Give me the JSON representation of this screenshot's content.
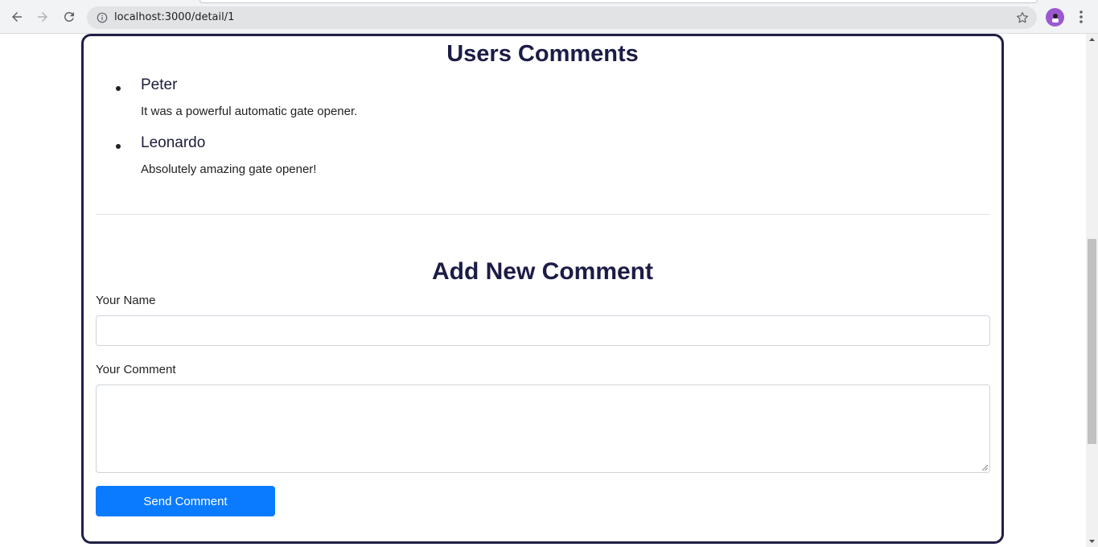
{
  "browser": {
    "url": "localhost:3000/detail/1",
    "back_icon": "arrow-left-icon",
    "forward_icon": "arrow-right-icon",
    "reload_icon": "reload-icon",
    "info_icon": "info-icon",
    "star_icon": "star-icon",
    "menu_icon": "kebab-menu-icon"
  },
  "comments_section": {
    "title": "Users Comments",
    "comments": [
      {
        "name": "Peter",
        "text": "It was a powerful automatic gate opener."
      },
      {
        "name": "Leonardo",
        "text": "Absolutely amazing gate opener!"
      }
    ]
  },
  "form": {
    "title": "Add New Comment",
    "name_label": "Your Name",
    "name_value": "",
    "comment_label": "Your Comment",
    "comment_value": "",
    "submit_label": "Send Comment"
  },
  "colors": {
    "heading": "#1c1c47",
    "card_border": "#1f1f45",
    "button": "#0a7bff"
  }
}
